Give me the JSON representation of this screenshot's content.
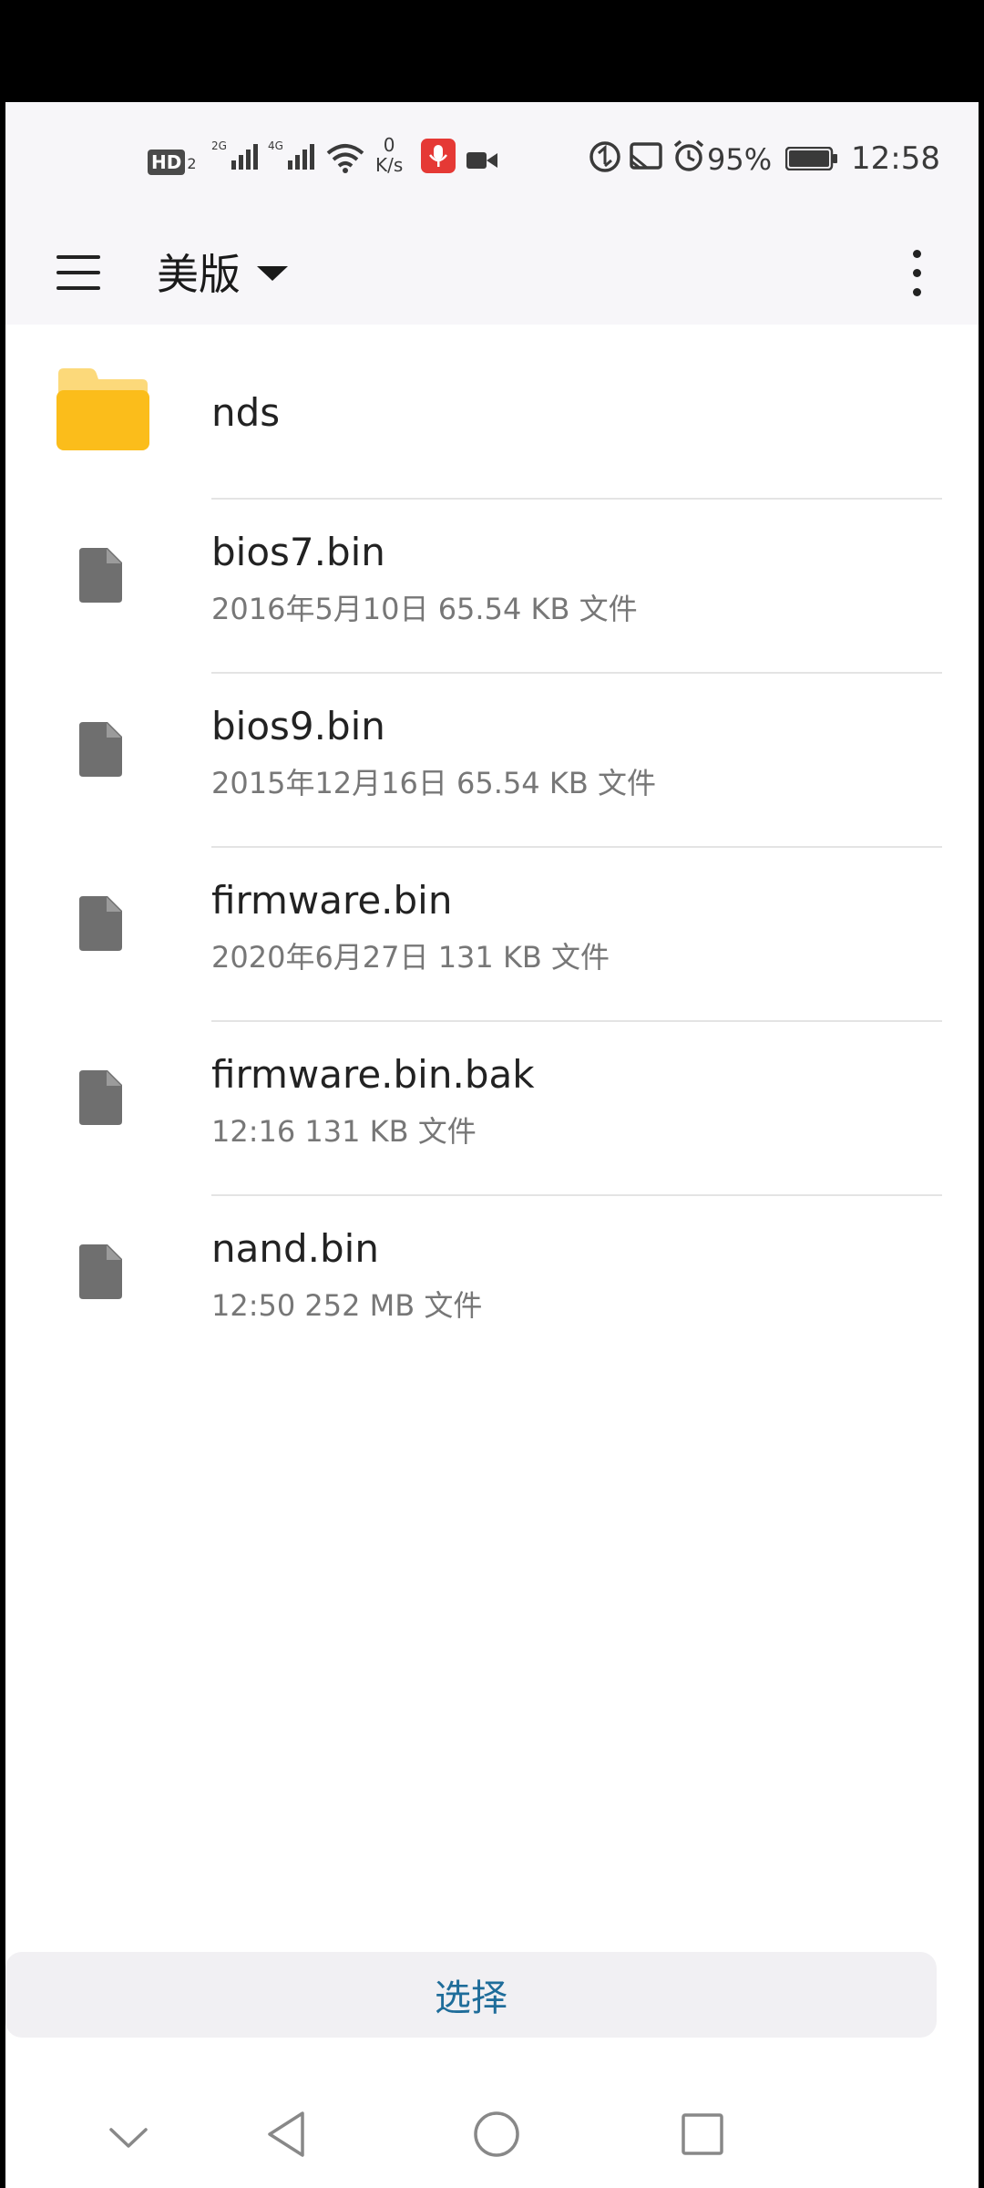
{
  "status_bar": {
    "hd_badge": "HD",
    "hd_sub": "2",
    "sim1_tag": "2G",
    "sim2_tag": "4G",
    "speed_value": "0",
    "speed_unit": "K/s",
    "battery": "95%",
    "time": "12:58",
    "icons": [
      "hd-icon",
      "signal-icon",
      "signal-icon",
      "wifi-icon",
      "mic-icon",
      "video-icon",
      "sync-icon",
      "cast-icon",
      "alarm-icon",
      "battery-icon"
    ],
    "accent_red": "#e53935"
  },
  "app_bar": {
    "title": "美版",
    "menu_icon": "hamburger-menu-icon",
    "dropdown_icon": "caret-down-icon",
    "more_icon": "more-vert-icon"
  },
  "files": [
    {
      "name": "nds",
      "meta": "",
      "type": "folder"
    },
    {
      "name": "bios7.bin",
      "meta": "2016年5月10日 65.54 KB 文件",
      "type": "file"
    },
    {
      "name": "bios9.bin",
      "meta": "2015年12月16日 65.54 KB 文件",
      "type": "file"
    },
    {
      "name": "firmware.bin",
      "meta": "2020年6月27日 131 KB 文件",
      "type": "file"
    },
    {
      "name": "firmware.bin.bak",
      "meta": "12:16 131 KB 文件",
      "type": "file"
    },
    {
      "name": "nand.bin",
      "meta": "12:50 252 MB 文件",
      "type": "file"
    }
  ],
  "bottom": {
    "select_label": "选择",
    "accent": "#1f6d9a"
  },
  "nav_bar": {
    "icons": [
      "collapse-chevron-icon",
      "back-icon",
      "home-icon",
      "recents-icon"
    ]
  }
}
